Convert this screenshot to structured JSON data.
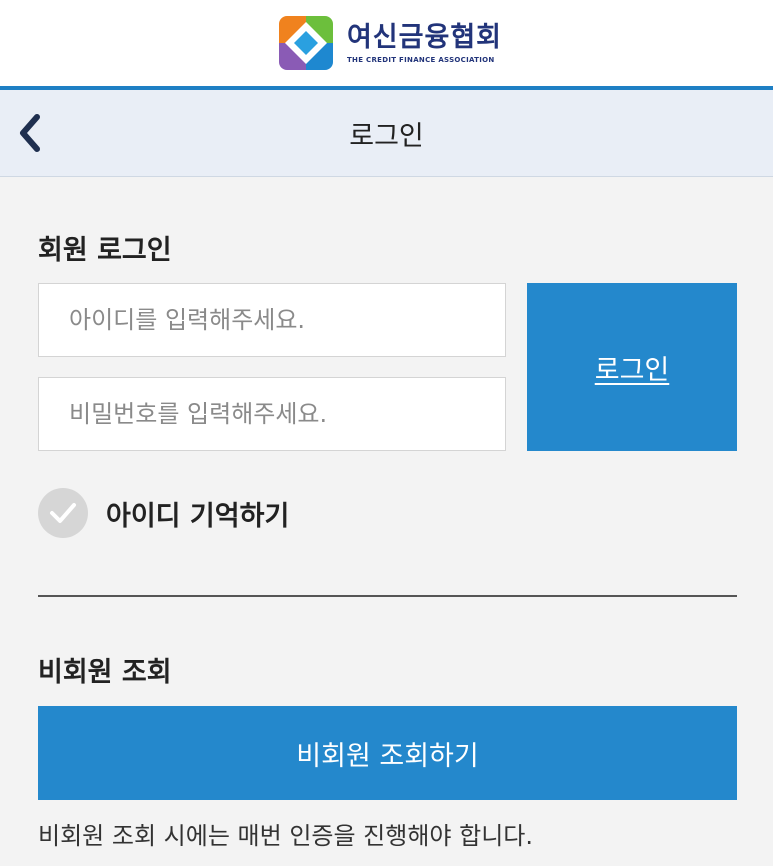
{
  "brand": {
    "name_ko": "여신금융협회",
    "name_en": "THE CREDIT FINANCE ASSOCIATION",
    "colors": {
      "orange": "#f0821e",
      "blue": "#1e88d0",
      "navy": "#22347a",
      "green": "#6cbf3c"
    }
  },
  "header": {
    "back_icon": "chevron-left-icon",
    "title": "로그인"
  },
  "member_login": {
    "section_title": "회원 로그인",
    "id_placeholder": "아이디를 입력해주세요.",
    "id_value": "",
    "pw_placeholder": "비밀번호를 입력해주세요.",
    "pw_value": "",
    "login_button": "로그인",
    "remember_icon": "checkmark-icon",
    "remember_label": "아이디 기억하기",
    "remember_checked": false
  },
  "guest": {
    "section_title": "비회원 조회",
    "button_label": "비회원 조회하기",
    "note": "비회원 조회 시에는 매번 인증을 진행해야 합니다."
  },
  "theme": {
    "accent": "#2488cc",
    "header_bg": "#e9eef6",
    "page_bg": "#f3f3f3"
  }
}
